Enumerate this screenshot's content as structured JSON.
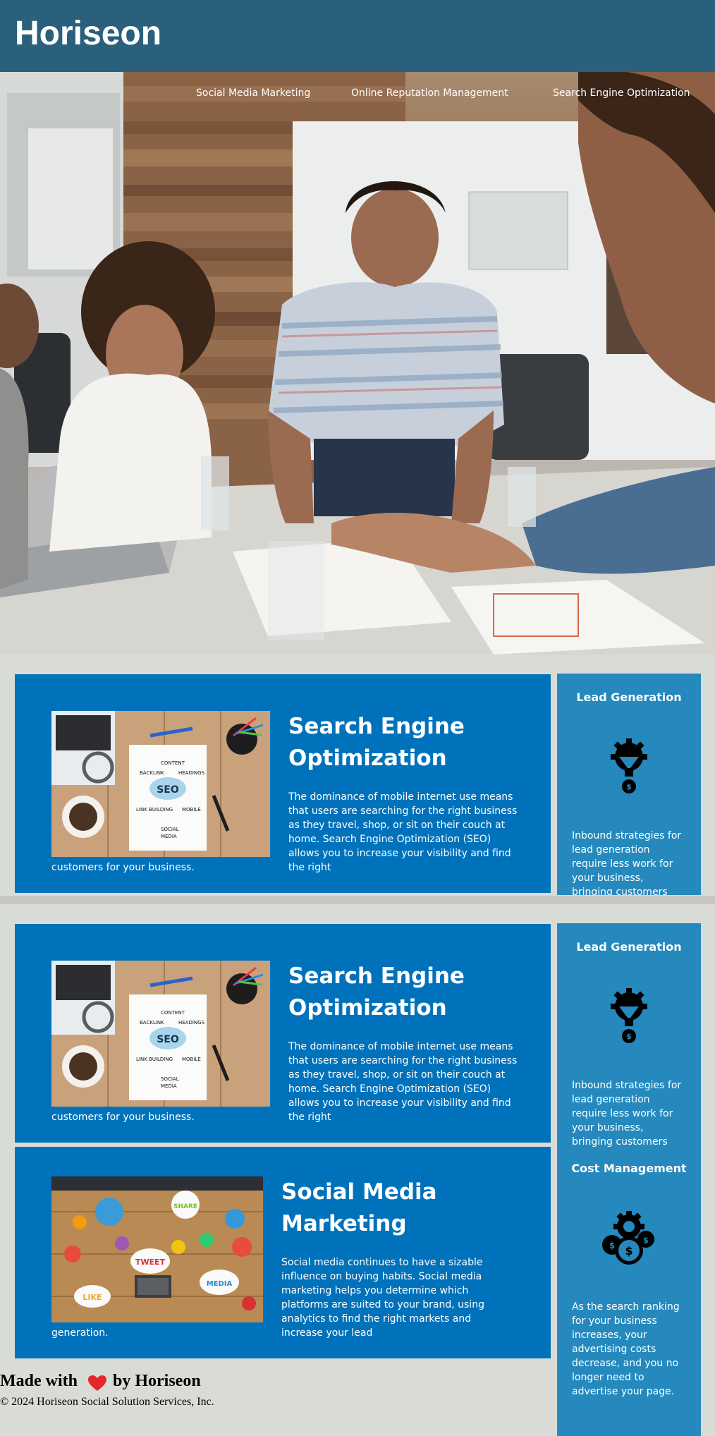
{
  "header": {
    "logo": "Horiseon"
  },
  "nav": {
    "items": [
      {
        "label": "Social Media Marketing"
      },
      {
        "label": "Online Reputation Management"
      },
      {
        "label": "Search Engine Optimization"
      }
    ]
  },
  "content": {
    "seo_card_1": {
      "title_line1": "Search Engine",
      "title_line2": "Optimization",
      "text": "The dominance of mobile internet use means that users are searching for the right business as they travel, shop, or sit on their couch at home. Search Engine Optimization (SEO) allows you to increase your visibility and find the right",
      "text_tail": "customers for your business."
    },
    "seo_card_2": {
      "title_line1": "Search Engine",
      "title_line2": "Optimization",
      "text": "The dominance of mobile internet use means that users are searching for the right business as they travel, shop, or sit on their couch at home. Search Engine Optimization (SEO) allows you to increase your visibility and find the right",
      "text_tail": "customers for your business."
    },
    "social_card": {
      "title_line1": "Social Media",
      "title_line2": "Marketing",
      "text": "Social media continues to have a sizable influence on buying habits. Social media marketing helps you determine which platforms are suited to your brand, using analytics to find the right markets and increase your lead",
      "text_tail": "generation."
    }
  },
  "sidebar": {
    "lead_1": {
      "title": "Lead Generation",
      "text": "Inbound strategies for lead generation require less work for your business, bringing customers directly to"
    },
    "lead_2": {
      "title": "Lead Generation",
      "text": "Inbound strategies for lead generation require less work for your business, bringing customers directly to"
    },
    "cost": {
      "title": "Cost Management",
      "text": "As the search ranking for your business increases, your advertising costs decrease, and you no longer need to advertise your page."
    }
  },
  "footer": {
    "made_with": "Made with",
    "by": "by Horiseon",
    "copyright": "© 2024 Horiseon Social Solution Services, Inc."
  },
  "colors": {
    "header": "#2a607c",
    "card": "#0072bb",
    "sidebar": "#2589bd",
    "page": "#d9dcd6"
  },
  "icons": [
    "lead-generation-icon",
    "cost-management-icon",
    "heart-icon"
  ]
}
